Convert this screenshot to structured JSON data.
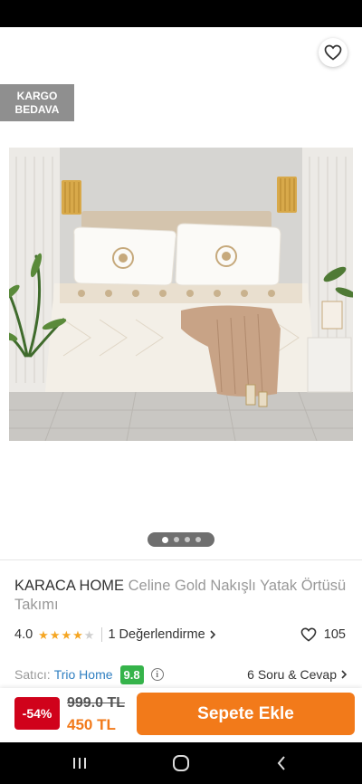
{
  "icons": {
    "back": "arrow-left-icon",
    "share": "share-icon",
    "favorite": "heart-icon",
    "info": "info-icon",
    "chevron": "chevron-right-icon"
  },
  "colors": {
    "brand_orange": "#f27a1a",
    "discount_red": "#d0021b",
    "seller_blue": "#2f7fc1",
    "seller_score_green": "#35b34a",
    "star_yellow": "#f5a623",
    "cargo_badge_grey": "#8f8f8f"
  },
  "cargo_badge": {
    "line1": "KARGO",
    "line2": "BEDAVA"
  },
  "gallery": {
    "image_count": 4,
    "active_index": 0
  },
  "product": {
    "brand": "KARACA HOME",
    "name": "Celine Gold Nakışlı Yatak Örtüsü Takımı",
    "rating": "4.0",
    "stars_filled": 4,
    "stars_total": 5,
    "reviews_label": "1 Değerlendirme",
    "favorite_count": "105"
  },
  "seller": {
    "prefix": "Satıcı:",
    "name": "Trio Home",
    "score": "9.8",
    "qa_label": "6 Soru & Cevap"
  },
  "pricing": {
    "discount": "-54%",
    "old_price": "999.0 TL",
    "new_price": "450 TL",
    "add_to_cart": "Sepete Ekle"
  }
}
